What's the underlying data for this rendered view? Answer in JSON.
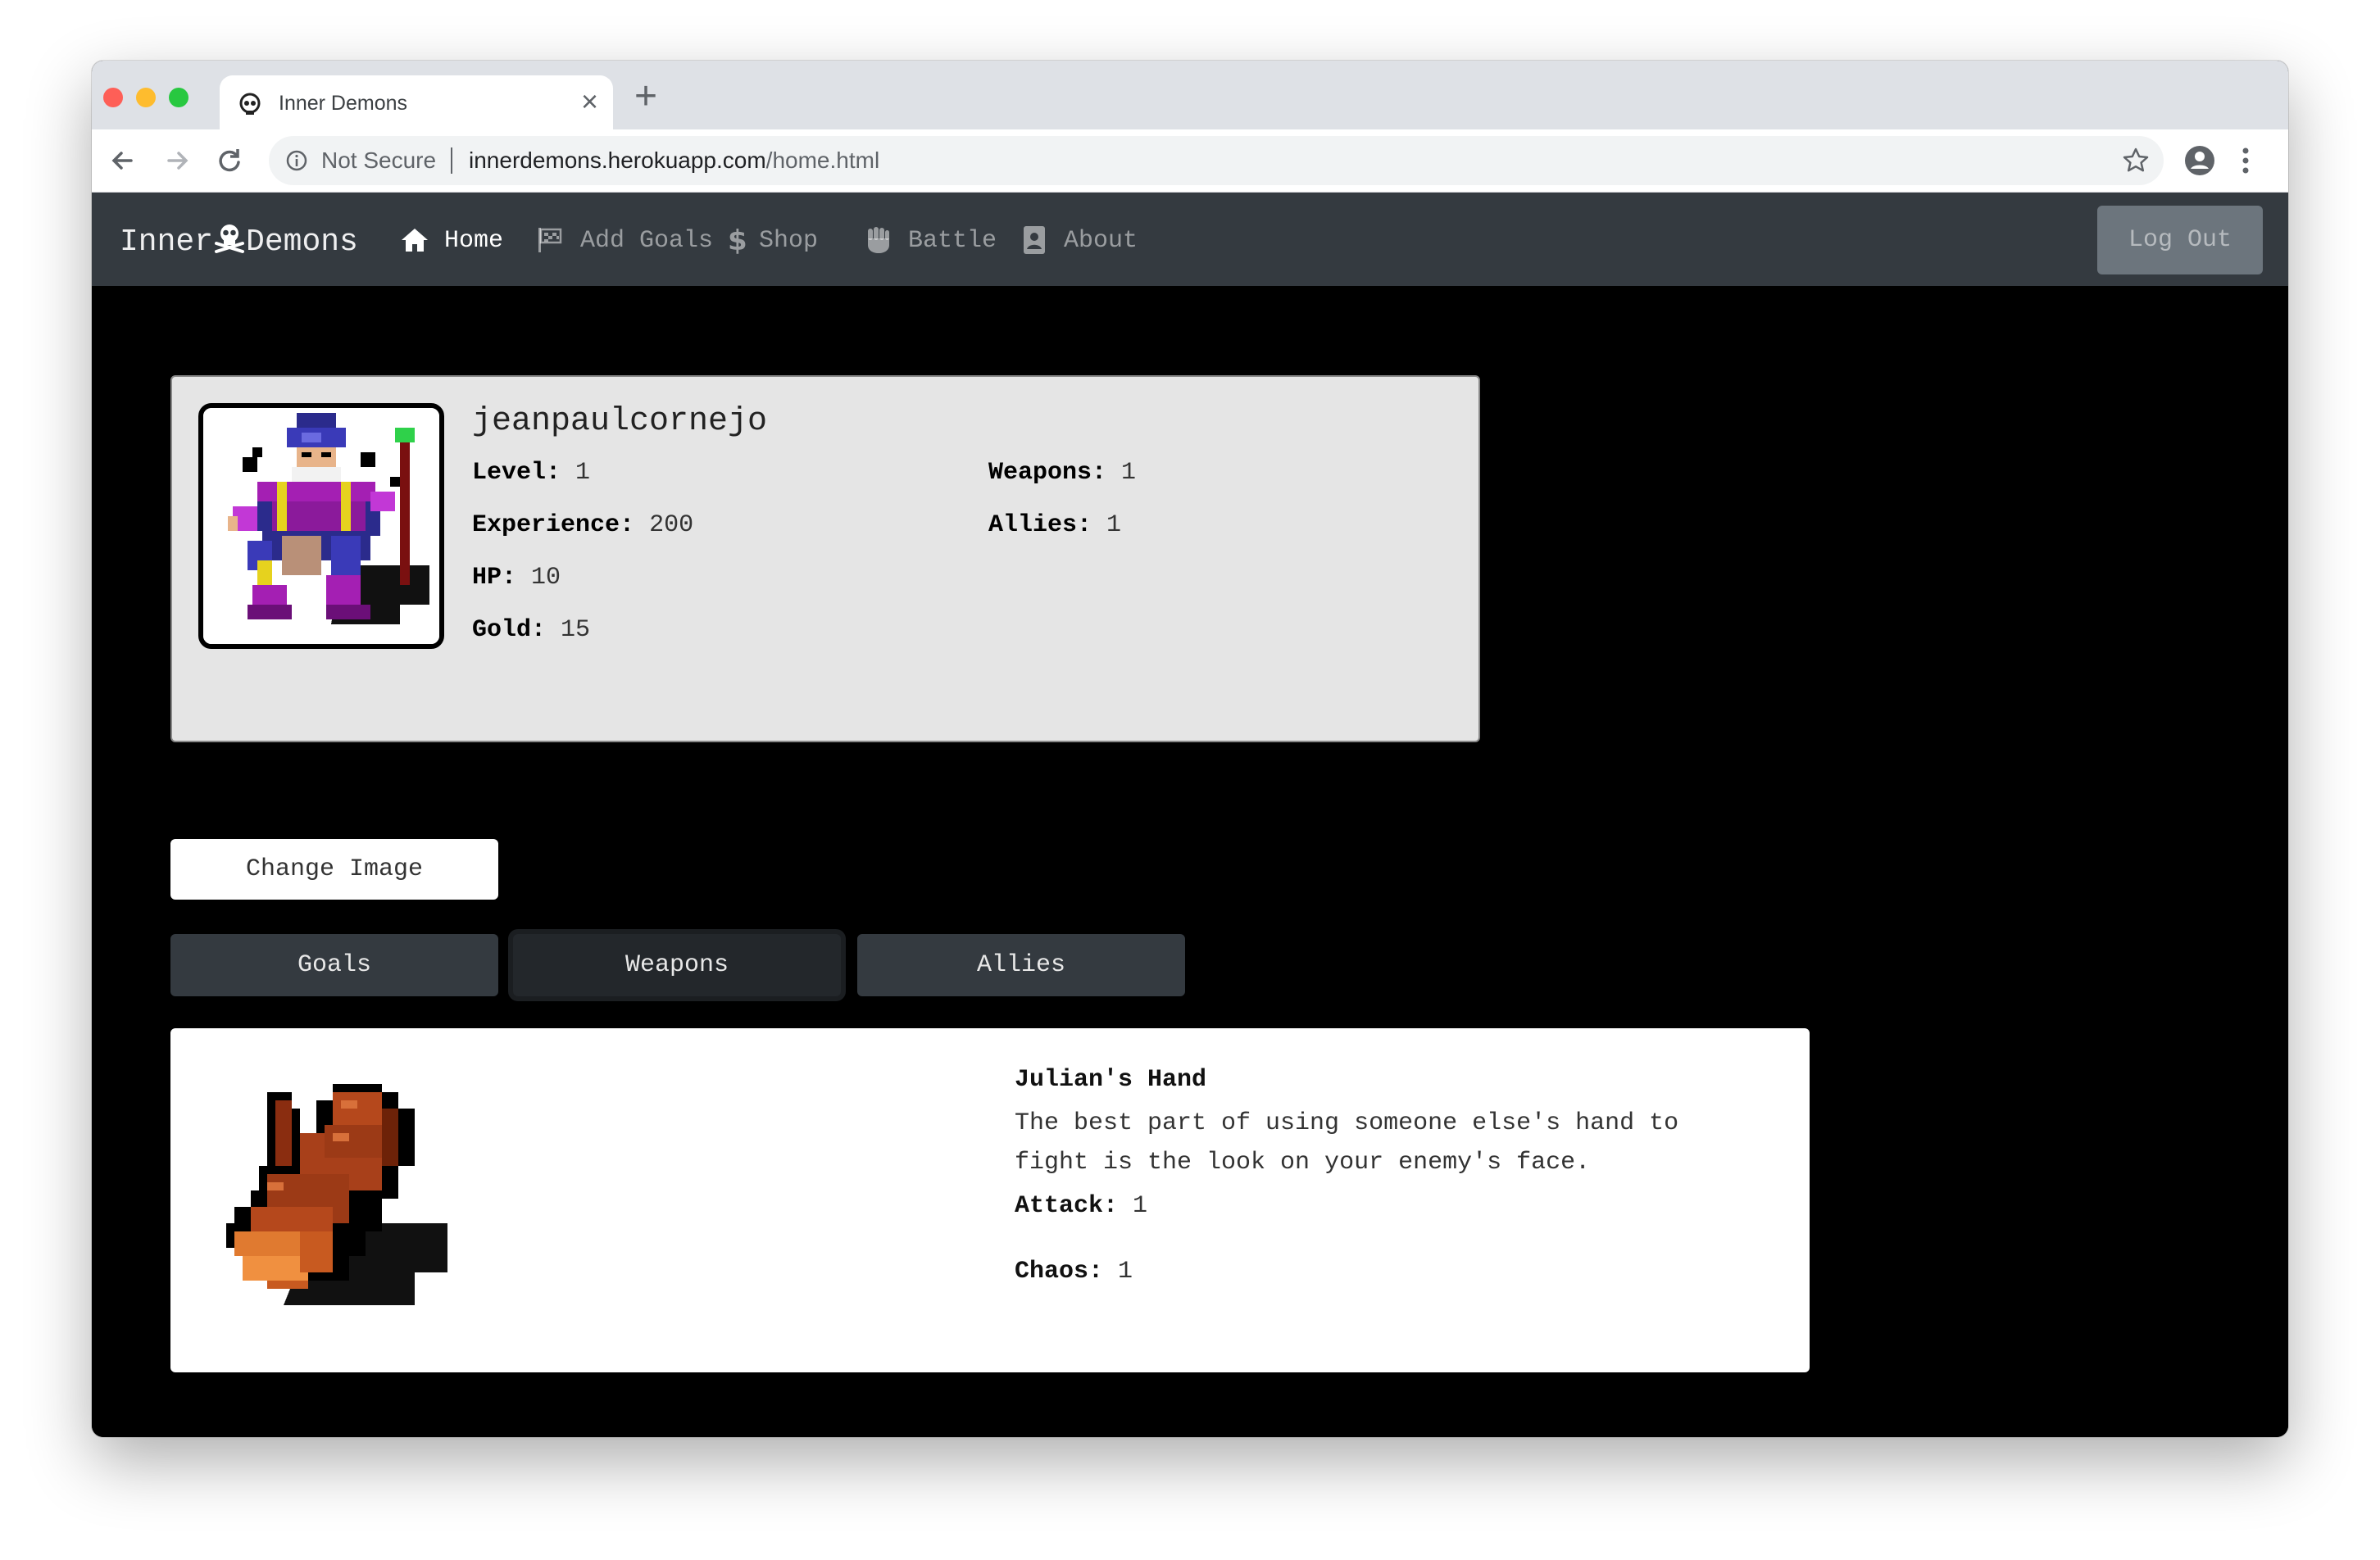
{
  "browser": {
    "tab_title": "Inner Demons",
    "not_secure_label": "Not Secure",
    "url_domain": "innerdemons.herokuapp.com",
    "url_path": "/home.html"
  },
  "navbar": {
    "brand_left": "Inner",
    "brand_right": "Demons",
    "links": [
      {
        "label": "Home",
        "icon": "home-icon"
      },
      {
        "label": "Add Goals",
        "icon": "flag-icon"
      },
      {
        "label": "Shop",
        "icon": "dollar-icon"
      },
      {
        "label": "Battle",
        "icon": "fist-icon"
      },
      {
        "label": "About",
        "icon": "id-badge-icon"
      }
    ],
    "logout_label": "Log Out"
  },
  "profile": {
    "username": "jeanpaulcornejo",
    "level_label": "Level:",
    "level": "1",
    "experience_label": "Experience:",
    "experience": "200",
    "hp_label": "HP:",
    "hp": "10",
    "gold_label": "Gold:",
    "gold": "15",
    "weapons_label": "Weapons:",
    "weapons": "1",
    "allies_label": "Allies:",
    "allies": "1"
  },
  "change_image_label": "Change Image",
  "tabs": [
    {
      "label": "Goals"
    },
    {
      "label": "Weapons"
    },
    {
      "label": "Allies"
    }
  ],
  "active_tab": "Weapons",
  "weapon": {
    "name": "Julian's Hand",
    "description": "The best part of using someone else's hand to fight is the look on your enemy's face.",
    "attack_label": "Attack:",
    "attack": "1",
    "chaos_label": "Chaos:",
    "chaos": "1"
  },
  "colors": {
    "navbar_bg": "#343a40",
    "page_bg": "#000000",
    "card_bg": "#e5e5e5"
  }
}
